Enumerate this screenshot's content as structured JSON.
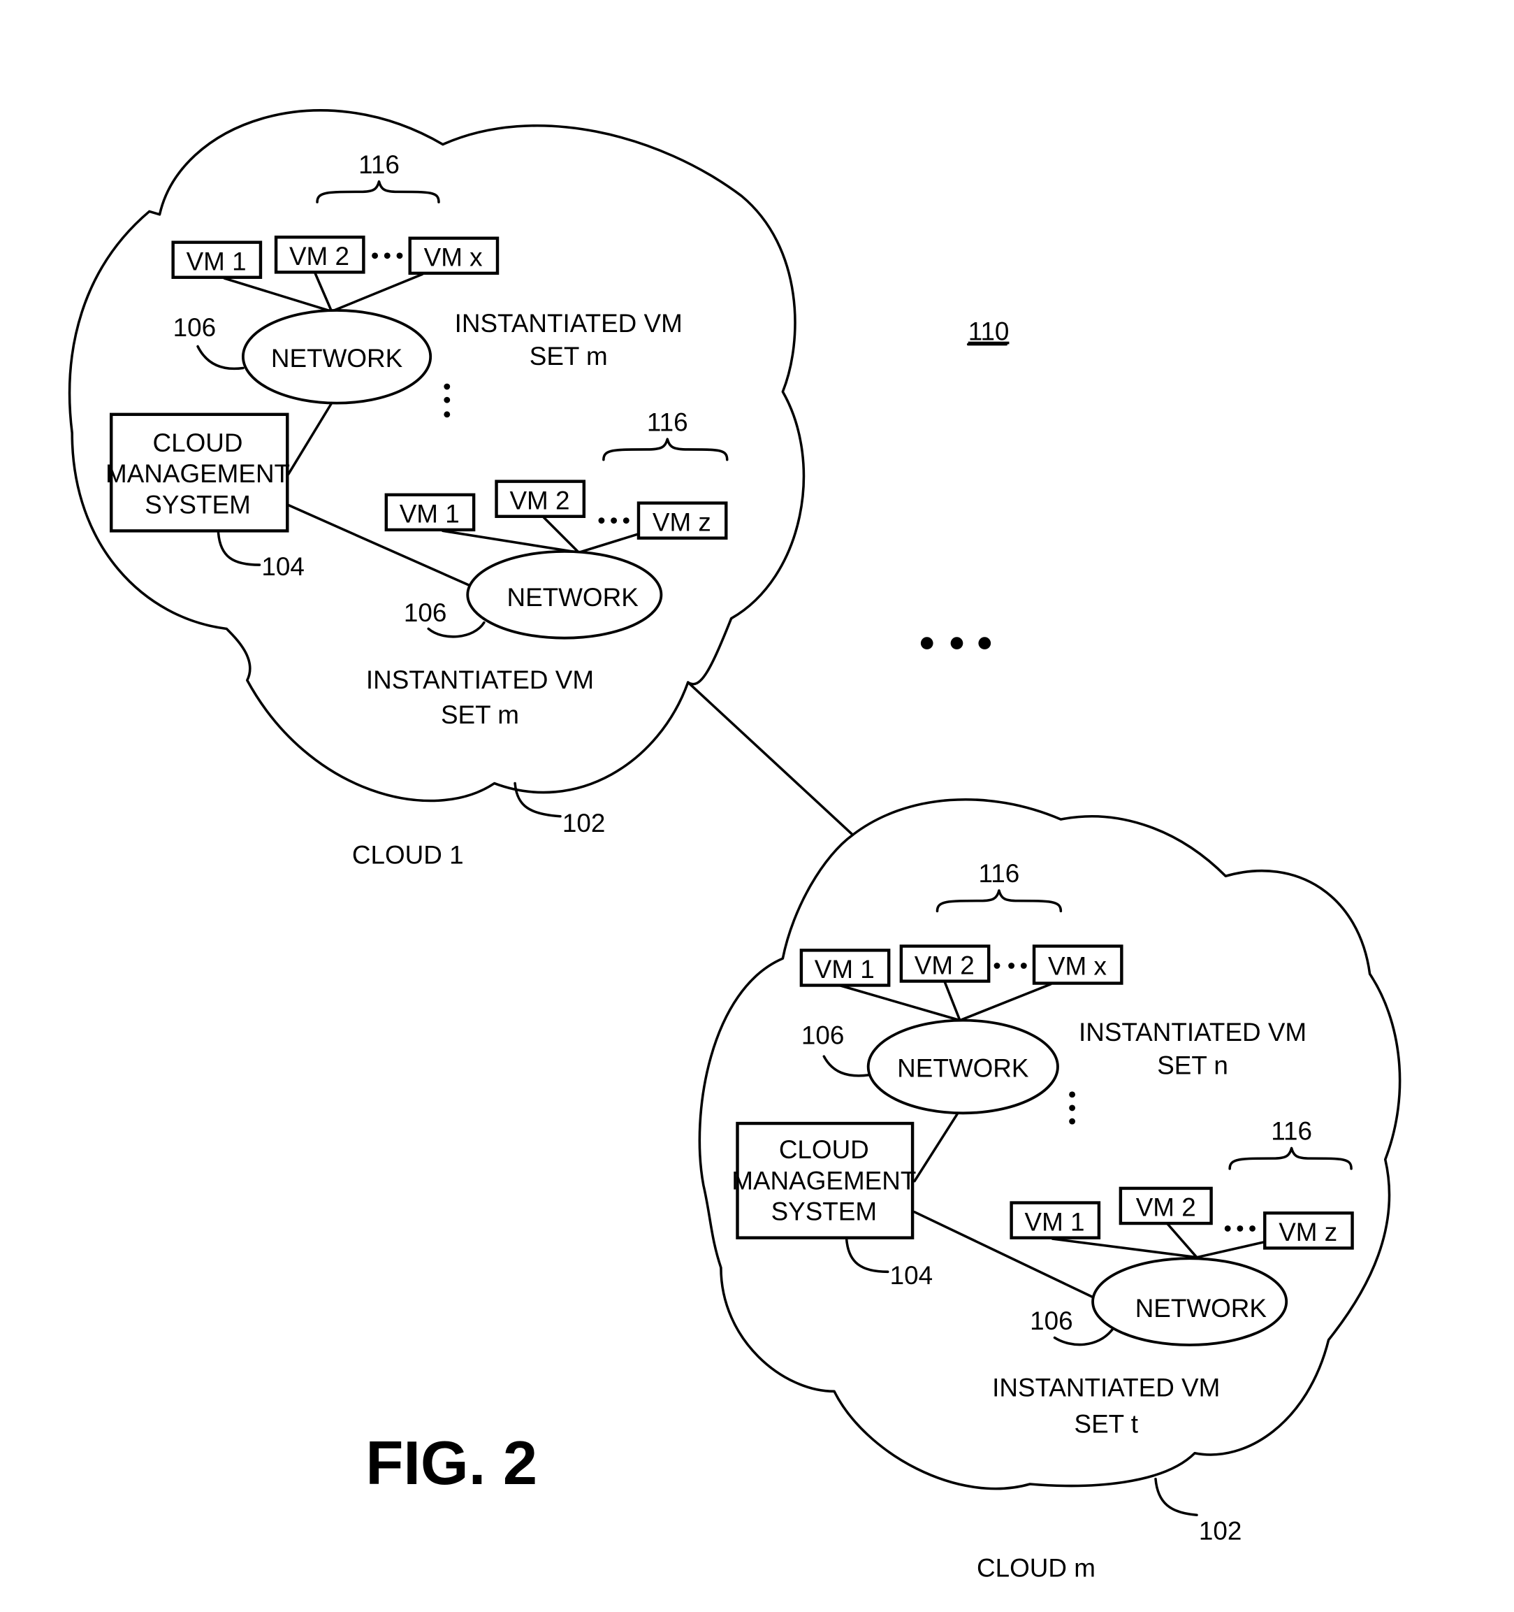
{
  "figure": {
    "title": "FIG. 2",
    "system_ref": "110",
    "between_clouds_ellipsis": "•••"
  },
  "clouds": [
    {
      "label": "CLOUD 1",
      "ref": "102",
      "cms": {
        "lines": [
          "CLOUD",
          "MANAGEMENT",
          "SYSTEM"
        ],
        "ref": "104"
      },
      "vm_sets": [
        {
          "brace_ref": "116",
          "vms": [
            "VM 1",
            "VM 2",
            "VM x"
          ],
          "network": "NETWORK",
          "network_ref": "106",
          "caption": [
            "INSTANTIATED VM",
            "SET m"
          ]
        },
        {
          "brace_ref": "116",
          "vms": [
            "VM 1",
            "VM 2",
            "VM z"
          ],
          "network": "NETWORK",
          "network_ref": "106",
          "caption": [
            "INSTANTIATED VM",
            "SET m"
          ]
        }
      ]
    },
    {
      "label": "CLOUD m",
      "ref": "102",
      "cms": {
        "lines": [
          "CLOUD",
          "MANAGEMENT",
          "SYSTEM"
        ],
        "ref": "104"
      },
      "vm_sets": [
        {
          "brace_ref": "116",
          "vms": [
            "VM 1",
            "VM 2",
            "VM x"
          ],
          "network": "NETWORK",
          "network_ref": "106",
          "caption": [
            "INSTANTIATED VM",
            "SET n"
          ]
        },
        {
          "brace_ref": "116",
          "vms": [
            "VM 1",
            "VM 2",
            "VM z"
          ],
          "network": "NETWORK",
          "network_ref": "106",
          "caption": [
            "INSTANTIATED VM",
            "SET t"
          ]
        }
      ]
    }
  ]
}
